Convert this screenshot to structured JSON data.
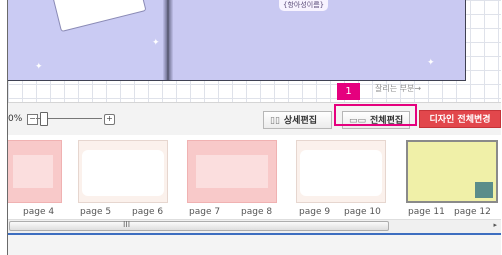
{
  "editor": {
    "caption_tag": "{항아성이름}",
    "cut_area_label": "잘리는 부분→"
  },
  "toolbar": {
    "zoom_text": "0%",
    "zoom_minus": "−",
    "zoom_plus": "+",
    "detail_icon": "▯▯",
    "detail_label": "상세편집",
    "all_icon": "▭▭",
    "all_label": "전체편집",
    "design_label": "디자인 전체변경",
    "step_badge": "1"
  },
  "thumbnails": {
    "labels": [
      "page 4",
      "page 5",
      "page 6",
      "page 7",
      "page 8",
      "page 9",
      "page 10",
      "page 11",
      "page 12"
    ]
  },
  "scrollbar": {
    "grip": "III",
    "right_arrow": "▸"
  }
}
